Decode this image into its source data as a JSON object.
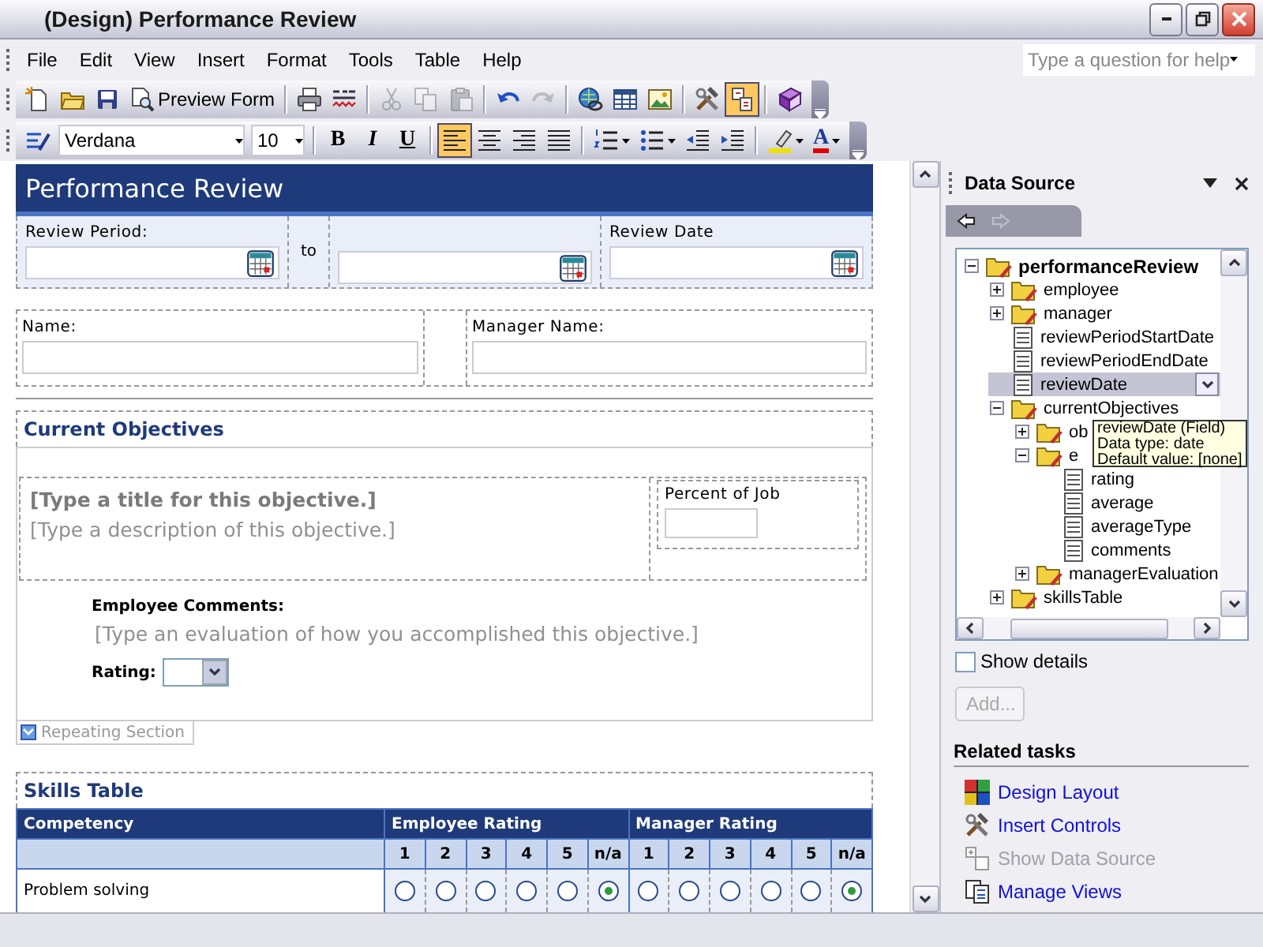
{
  "window": {
    "title": "(Design) Performance Review"
  },
  "menu": [
    "File",
    "Edit",
    "View",
    "Insert",
    "Format",
    "Tools",
    "Table",
    "Help"
  ],
  "help_box": {
    "placeholder": "Type a question for help"
  },
  "standard_toolbar": {
    "groups": [
      [
        {
          "kind": "new",
          "pressed": false,
          "disabled": false
        },
        {
          "kind": "open",
          "pressed": false,
          "disabled": false
        },
        {
          "kind": "save",
          "pressed": false,
          "disabled": false
        },
        {
          "kind": "preview",
          "label": "Preview Form",
          "pressed": false,
          "disabled": false
        }
      ],
      [
        {
          "kind": "print",
          "pressed": false,
          "disabled": false
        },
        {
          "kind": "spell",
          "pressed": false,
          "disabled": false
        }
      ],
      [
        {
          "kind": "cut",
          "pressed": false,
          "disabled": true
        },
        {
          "kind": "copy",
          "pressed": false,
          "disabled": true
        },
        {
          "kind": "paste",
          "pressed": false,
          "disabled": true
        }
      ],
      [
        {
          "kind": "undo",
          "pressed": false,
          "disabled": false
        },
        {
          "kind": "redo",
          "pressed": false,
          "disabled": true
        }
      ],
      [
        {
          "kind": "hyperlink",
          "pressed": false,
          "disabled": false
        },
        {
          "kind": "table",
          "pressed": false,
          "disabled": false
        },
        {
          "kind": "picture",
          "pressed": false,
          "disabled": false
        }
      ],
      [
        {
          "kind": "controls",
          "pressed": false,
          "disabled": false
        },
        {
          "kind": "layout",
          "pressed": true,
          "disabled": false
        }
      ],
      [
        {
          "kind": "help",
          "pressed": false,
          "disabled": false
        }
      ]
    ]
  },
  "formatting_toolbar": {
    "groups": [
      [
        {
          "kind": "styles",
          "pressed": false
        },
        {
          "kind": "font-box",
          "value": "Verdana"
        },
        {
          "kind": "size-box",
          "value": "10"
        }
      ],
      [
        {
          "kind": "bold",
          "label": "B",
          "pressed": false
        },
        {
          "kind": "italic",
          "label": "I",
          "pressed": false
        },
        {
          "kind": "underline",
          "label": "U",
          "pressed": false
        }
      ],
      [
        {
          "kind": "align-left",
          "pressed": true
        },
        {
          "kind": "align-center",
          "pressed": false
        },
        {
          "kind": "align-right",
          "pressed": false
        },
        {
          "kind": "justify",
          "pressed": false
        }
      ],
      [
        {
          "kind": "numbering",
          "pressed": false
        },
        {
          "kind": "bullets",
          "pressed": false
        },
        {
          "kind": "outdent",
          "pressed": false
        },
        {
          "kind": "indent",
          "pressed": false
        }
      ],
      [
        {
          "kind": "highlight",
          "pressed": false
        },
        {
          "kind": "font-color",
          "label": "A",
          "pressed": false
        }
      ]
    ]
  },
  "form": {
    "title": "Performance Review",
    "review_period": {
      "label": "Review Period:",
      "to": "to"
    },
    "review_date": {
      "label": "Review Date"
    },
    "name": {
      "label": "Name:"
    },
    "manager_name": {
      "label": "Manager Name:"
    },
    "objectives": {
      "heading": "Current Objectives",
      "objective_title": {
        "placeholder": "[Type a title for this objective.]"
      },
      "objective_description": {
        "placeholder": "[Type a description of this objective.]"
      },
      "percent_of_job": {
        "label": "Percent of Job"
      },
      "employee_comments": {
        "label": "Employee Comments:",
        "placeholder": "[Type an evaluation of how you accomplished this objective.]"
      },
      "rating": {
        "label": "Rating:"
      },
      "section_tag": "Repeating Section"
    },
    "skills": {
      "heading": "Skills Table",
      "columns": [
        "Competency",
        "Employee Rating",
        "Manager Rating"
      ],
      "employee_scale": [
        "1",
        "2",
        "3",
        "4",
        "5",
        "n/a"
      ],
      "manager_scale": [
        "1",
        "2",
        "3",
        "4",
        "5",
        "n/a"
      ],
      "rows": [
        {
          "competency": "Problem solving",
          "employee_rating": [
            {
              "selected": false
            },
            {
              "selected": false
            },
            {
              "selected": false
            },
            {
              "selected": false
            },
            {
              "selected": false
            },
            {
              "selected": true
            }
          ],
          "manager_rating": [
            {
              "selected": false
            },
            {
              "selected": false
            },
            {
              "selected": false
            },
            {
              "selected": false
            },
            {
              "selected": false
            },
            {
              "selected": true
            }
          ]
        }
      ]
    }
  },
  "task_pane": {
    "title": "Data Source",
    "tree": [
      {
        "label": "performanceReview",
        "kind": "group",
        "expanded": true,
        "selected": false,
        "children": [
          {
            "label": "employee",
            "kind": "group",
            "expanded": false,
            "selected": false
          },
          {
            "label": "manager",
            "kind": "group",
            "expanded": false,
            "selected": false
          },
          {
            "label": "reviewPeriodStartDate",
            "kind": "field",
            "selected": false
          },
          {
            "label": "reviewPeriodEndDate",
            "kind": "field",
            "selected": false
          },
          {
            "label": "reviewDate",
            "kind": "field",
            "selected": true
          },
          {
            "label": "currentObjectives",
            "kind": "group",
            "expanded": true,
            "selected": false,
            "children": [
              {
                "label": "ob",
                "kind": "group",
                "expanded": false,
                "selected": false
              },
              {
                "label": "e",
                "kind": "group",
                "expanded": true,
                "selected": false,
                "children": [
                  {
                    "label": "rating",
                    "kind": "field",
                    "selected": false
                  },
                  {
                    "label": "average",
                    "kind": "field",
                    "selected": false
                  },
                  {
                    "label": "averageType",
                    "kind": "field",
                    "selected": false
                  },
                  {
                    "label": "comments",
                    "kind": "field",
                    "selected": false
                  }
                ]
              },
              {
                "label": "managerEvaluation",
                "kind": "group",
                "expanded": false,
                "selected": false
              }
            ]
          },
          {
            "label": "skillsTable",
            "kind": "group",
            "expanded": false,
            "selected": false
          }
        ]
      }
    ],
    "tooltip": [
      "reviewDate (Field)",
      "Data type: date",
      "Default value: [none]"
    ],
    "show_details": {
      "label": "Show details",
      "checked": false
    },
    "add_button": {
      "label": "Add...",
      "disabled": true
    },
    "related_heading": "Related tasks",
    "tasks": [
      {
        "label": "Design Layout",
        "kind": "layout",
        "disabled": false
      },
      {
        "label": "Insert Controls",
        "kind": "controls",
        "disabled": false
      },
      {
        "label": "Show Data Source",
        "kind": "datasource",
        "disabled": true
      },
      {
        "label": "Manage Views",
        "kind": "views",
        "disabled": false
      }
    ]
  }
}
